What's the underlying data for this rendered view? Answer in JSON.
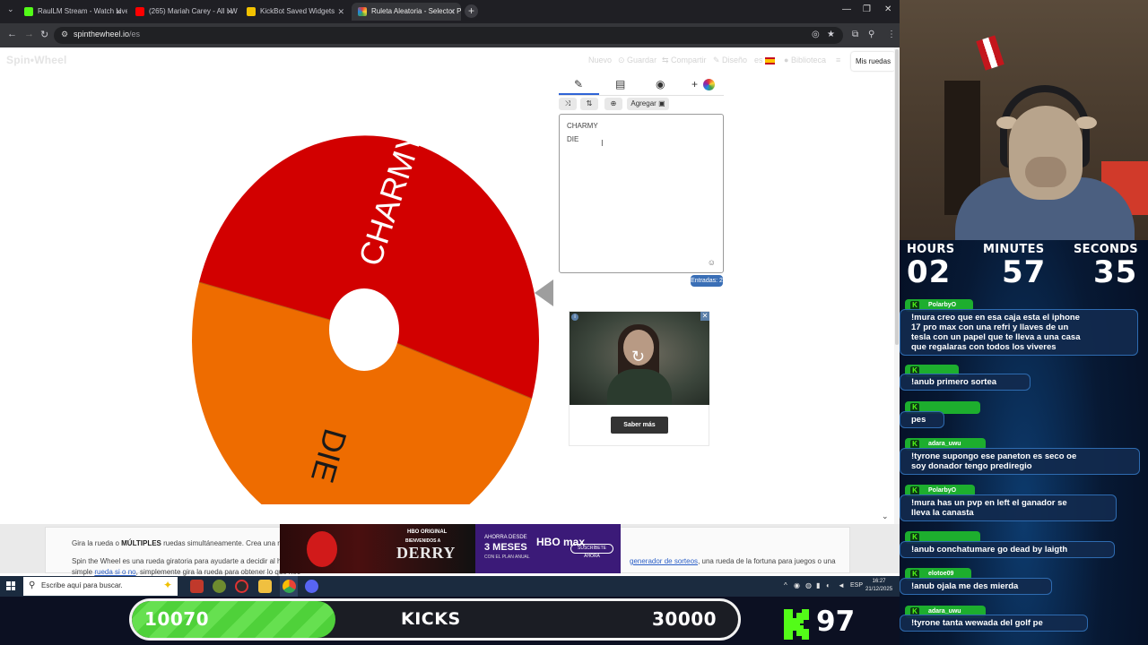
{
  "browser": {
    "tabs": [
      {
        "title": "RaulLM Stream - Watch Live o",
        "icon_color": "#53fc18",
        "active": false
      },
      {
        "title": "(265) Mariah Carey - All I W",
        "icon_color": "#ff0000",
        "active": false
      },
      {
        "title": "KickBot Saved Widgets",
        "icon_color": "#f2c200",
        "active": false
      },
      {
        "title": "Ruleta Aleatoria - Selector Pers",
        "icon_color": "#4a7fe0",
        "active": true
      }
    ],
    "url_host": "spinthewheel.io",
    "url_path": "/es"
  },
  "site": {
    "logo": "Spin•Wheel",
    "menu": {
      "nuevo": "Nuevo",
      "guardar": "Guardar",
      "compartir": "Compartir",
      "diseno": "Diseño",
      "lang": "es",
      "biblioteca": "Biblioteca",
      "mis_ruedas": "Mis ruedas"
    },
    "wheel": {
      "slices": [
        {
          "label": "CHARMY",
          "color": "#d20000"
        },
        {
          "label": "DIE",
          "color": "#ee6c00"
        }
      ]
    },
    "editor": {
      "add_button": "Agregar",
      "entries": [
        "CHARMY",
        "DIE"
      ],
      "entries_badge": "Entradas: 2"
    },
    "ad": {
      "cta": "Saber más"
    },
    "text": {
      "line1_prefix": "Gira la rueda o ",
      "line1_bold": "MÚLTIPLES",
      "line1_suffix": " ruedas simultáneamente. Crea una rueda p",
      "line2": "Spin the Wheel es una rueda giratoria para ayudarte a decidir al hacer u",
      "line2_right_link": "generador de sorteos",
      "line2_right_text": ", una rueda de la fortuna para juegos o una",
      "line3_prefix": "simple ",
      "line3_link": "rueda si o no",
      "line3_suffix": ", simplemente gira la rueda para obtener lo que nec"
    },
    "banner": {
      "hbo_original": "HBO ORIGINAL",
      "welcome": "BIENVENIDOS A",
      "derry": "DERRY",
      "ahorra": "AHORRA DESDE",
      "meses": "3 MESES",
      "plan": "CON EL PLAN ANUAL",
      "hbomax": "HBO max",
      "suscribete": "SUSCRÍBETE AHORA"
    }
  },
  "taskbar": {
    "search_placeholder": "Escribe aquí para buscar.",
    "lang": "ESP",
    "time": "16:27",
    "date": "21/12/2025"
  },
  "kicks": {
    "current": "10070",
    "label": "KICKS",
    "goal": "30000",
    "progress": 0.336,
    "count": "97"
  },
  "timer": {
    "hours_label": "HOURS",
    "hours": "02",
    "minutes_label": "MINUTES",
    "minutes": "57",
    "seconds_label": "SECONDS",
    "seconds": "35"
  },
  "chat": [
    {
      "user": "PolarbyO",
      "text": [
        "!mura creo que en esa caja esta el iphone",
        "17 pro max con una refri y llaves de un",
        "tesla con un papel que te lleva a una casa",
        "que regalaras con todos los viveres"
      ]
    },
    {
      "user": "",
      "text": [
        "!anub primero sortea"
      ]
    },
    {
      "user": "",
      "text": [
        "pes"
      ]
    },
    {
      "user": "adara_uwu",
      "text": [
        "!tyrone supongo ese paneton es seco oe",
        "soy donador tengo prediregio"
      ]
    },
    {
      "user": "PolarbyO",
      "text": [
        "!mura has un pvp en left el ganador se",
        "lleva la canasta"
      ]
    },
    {
      "user": "",
      "text": [
        "!anub conchatumare go dead by laigth"
      ]
    },
    {
      "user": "elotoe09",
      "text": [
        "!anub ojala me des mierda"
      ]
    },
    {
      "user": "adara_uwu",
      "text": [
        "!tyrone tanta wewada del golf pe"
      ]
    }
  ]
}
